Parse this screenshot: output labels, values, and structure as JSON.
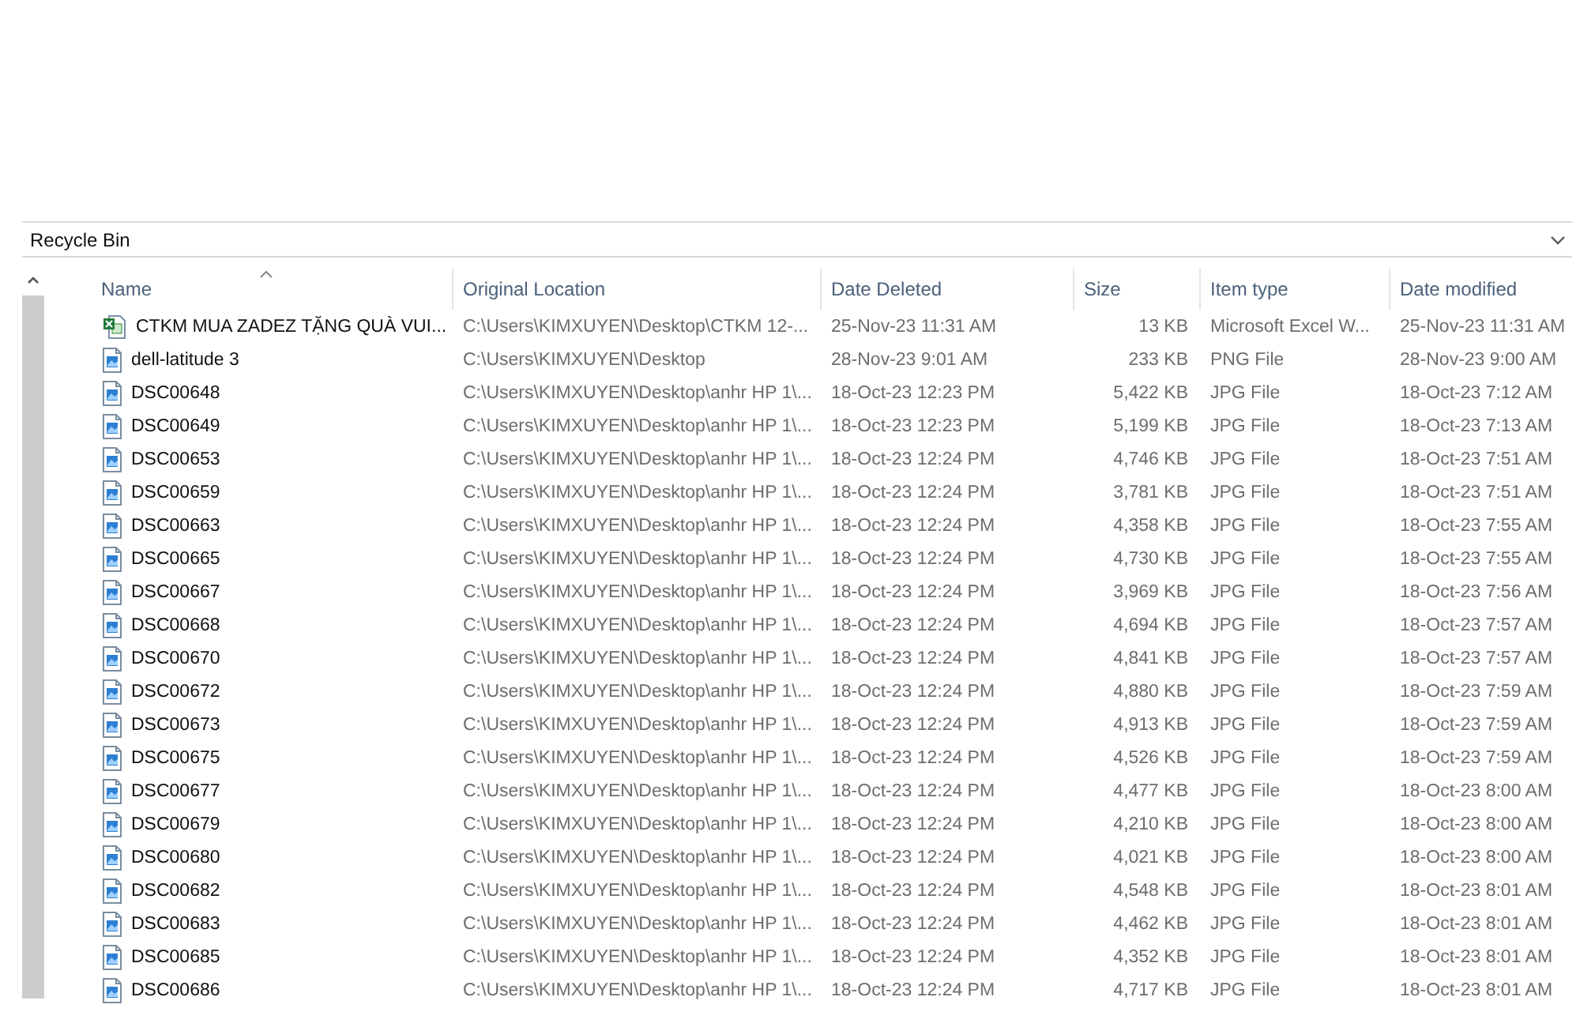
{
  "address_bar": {
    "location": "Recycle Bin"
  },
  "table": {
    "columns": [
      {
        "label": "Name",
        "sorted": true
      },
      {
        "label": "Original Location",
        "sorted": false
      },
      {
        "label": "Date Deleted",
        "sorted": false
      },
      {
        "label": "Size",
        "sorted": false
      },
      {
        "label": "Item type",
        "sorted": false
      },
      {
        "label": "Date modified",
        "sorted": false
      }
    ],
    "rows": [
      {
        "kind": "excel",
        "cells": [
          "CTKM MUA ZADEZ TẶNG QUÀ VUI...",
          "C:\\Users\\KIMXUYEN\\Desktop\\CTKM 12-...",
          "25-Nov-23 11:31 AM",
          "13 KB",
          "Microsoft Excel W...",
          "25-Nov-23 11:31 AM"
        ]
      },
      {
        "kind": "image",
        "cells": [
          "dell-latitude 3",
          "C:\\Users\\KIMXUYEN\\Desktop",
          "28-Nov-23 9:01 AM",
          "233 KB",
          "PNG File",
          "28-Nov-23 9:00 AM"
        ]
      },
      {
        "kind": "image",
        "cells": [
          "DSC00648",
          "C:\\Users\\KIMXUYEN\\Desktop\\anhr HP 1\\...",
          "18-Oct-23 12:23 PM",
          "5,422 KB",
          "JPG File",
          "18-Oct-23 7:12 AM"
        ]
      },
      {
        "kind": "image",
        "cells": [
          "DSC00649",
          "C:\\Users\\KIMXUYEN\\Desktop\\anhr HP 1\\...",
          "18-Oct-23 12:23 PM",
          "5,199 KB",
          "JPG File",
          "18-Oct-23 7:13 AM"
        ]
      },
      {
        "kind": "image",
        "cells": [
          "DSC00653",
          "C:\\Users\\KIMXUYEN\\Desktop\\anhr HP 1\\...",
          "18-Oct-23 12:24 PM",
          "4,746 KB",
          "JPG File",
          "18-Oct-23 7:51 AM"
        ]
      },
      {
        "kind": "image",
        "cells": [
          "DSC00659",
          "C:\\Users\\KIMXUYEN\\Desktop\\anhr HP 1\\...",
          "18-Oct-23 12:24 PM",
          "3,781 KB",
          "JPG File",
          "18-Oct-23 7:51 AM"
        ]
      },
      {
        "kind": "image",
        "cells": [
          "DSC00663",
          "C:\\Users\\KIMXUYEN\\Desktop\\anhr HP 1\\...",
          "18-Oct-23 12:24 PM",
          "4,358 KB",
          "JPG File",
          "18-Oct-23 7:55 AM"
        ]
      },
      {
        "kind": "image",
        "cells": [
          "DSC00665",
          "C:\\Users\\KIMXUYEN\\Desktop\\anhr HP 1\\...",
          "18-Oct-23 12:24 PM",
          "4,730 KB",
          "JPG File",
          "18-Oct-23 7:55 AM"
        ]
      },
      {
        "kind": "image",
        "cells": [
          "DSC00667",
          "C:\\Users\\KIMXUYEN\\Desktop\\anhr HP 1\\...",
          "18-Oct-23 12:24 PM",
          "3,969 KB",
          "JPG File",
          "18-Oct-23 7:56 AM"
        ]
      },
      {
        "kind": "image",
        "cells": [
          "DSC00668",
          "C:\\Users\\KIMXUYEN\\Desktop\\anhr HP 1\\...",
          "18-Oct-23 12:24 PM",
          "4,694 KB",
          "JPG File",
          "18-Oct-23 7:57 AM"
        ]
      },
      {
        "kind": "image",
        "cells": [
          "DSC00670",
          "C:\\Users\\KIMXUYEN\\Desktop\\anhr HP 1\\...",
          "18-Oct-23 12:24 PM",
          "4,841 KB",
          "JPG File",
          "18-Oct-23 7:57 AM"
        ]
      },
      {
        "kind": "image",
        "cells": [
          "DSC00672",
          "C:\\Users\\KIMXUYEN\\Desktop\\anhr HP 1\\...",
          "18-Oct-23 12:24 PM",
          "4,880 KB",
          "JPG File",
          "18-Oct-23 7:59 AM"
        ]
      },
      {
        "kind": "image",
        "cells": [
          "DSC00673",
          "C:\\Users\\KIMXUYEN\\Desktop\\anhr HP 1\\...",
          "18-Oct-23 12:24 PM",
          "4,913 KB",
          "JPG File",
          "18-Oct-23 7:59 AM"
        ]
      },
      {
        "kind": "image",
        "cells": [
          "DSC00675",
          "C:\\Users\\KIMXUYEN\\Desktop\\anhr HP 1\\...",
          "18-Oct-23 12:24 PM",
          "4,526 KB",
          "JPG File",
          "18-Oct-23 7:59 AM"
        ]
      },
      {
        "kind": "image",
        "cells": [
          "DSC00677",
          "C:\\Users\\KIMXUYEN\\Desktop\\anhr HP 1\\...",
          "18-Oct-23 12:24 PM",
          "4,477 KB",
          "JPG File",
          "18-Oct-23 8:00 AM"
        ]
      },
      {
        "kind": "image",
        "cells": [
          "DSC00679",
          "C:\\Users\\KIMXUYEN\\Desktop\\anhr HP 1\\...",
          "18-Oct-23 12:24 PM",
          "4,210 KB",
          "JPG File",
          "18-Oct-23 8:00 AM"
        ]
      },
      {
        "kind": "image",
        "cells": [
          "DSC00680",
          "C:\\Users\\KIMXUYEN\\Desktop\\anhr HP 1\\...",
          "18-Oct-23 12:24 PM",
          "4,021 KB",
          "JPG File",
          "18-Oct-23 8:00 AM"
        ]
      },
      {
        "kind": "image",
        "cells": [
          "DSC00682",
          "C:\\Users\\KIMXUYEN\\Desktop\\anhr HP 1\\...",
          "18-Oct-23 12:24 PM",
          "4,548 KB",
          "JPG File",
          "18-Oct-23 8:01 AM"
        ]
      },
      {
        "kind": "image",
        "cells": [
          "DSC00683",
          "C:\\Users\\KIMXUYEN\\Desktop\\anhr HP 1\\...",
          "18-Oct-23 12:24 PM",
          "4,462 KB",
          "JPG File",
          "18-Oct-23 8:01 AM"
        ]
      },
      {
        "kind": "image",
        "cells": [
          "DSC00685",
          "C:\\Users\\KIMXUYEN\\Desktop\\anhr HP 1\\...",
          "18-Oct-23 12:24 PM",
          "4,352 KB",
          "JPG File",
          "18-Oct-23 8:01 AM"
        ]
      },
      {
        "kind": "image",
        "cells": [
          "DSC00686",
          "C:\\Users\\KIMXUYEN\\Desktop\\anhr HP 1\\...",
          "18-Oct-23 12:24 PM",
          "4,717 KB",
          "JPG File",
          "18-Oct-23 8:01 AM"
        ]
      }
    ]
  }
}
